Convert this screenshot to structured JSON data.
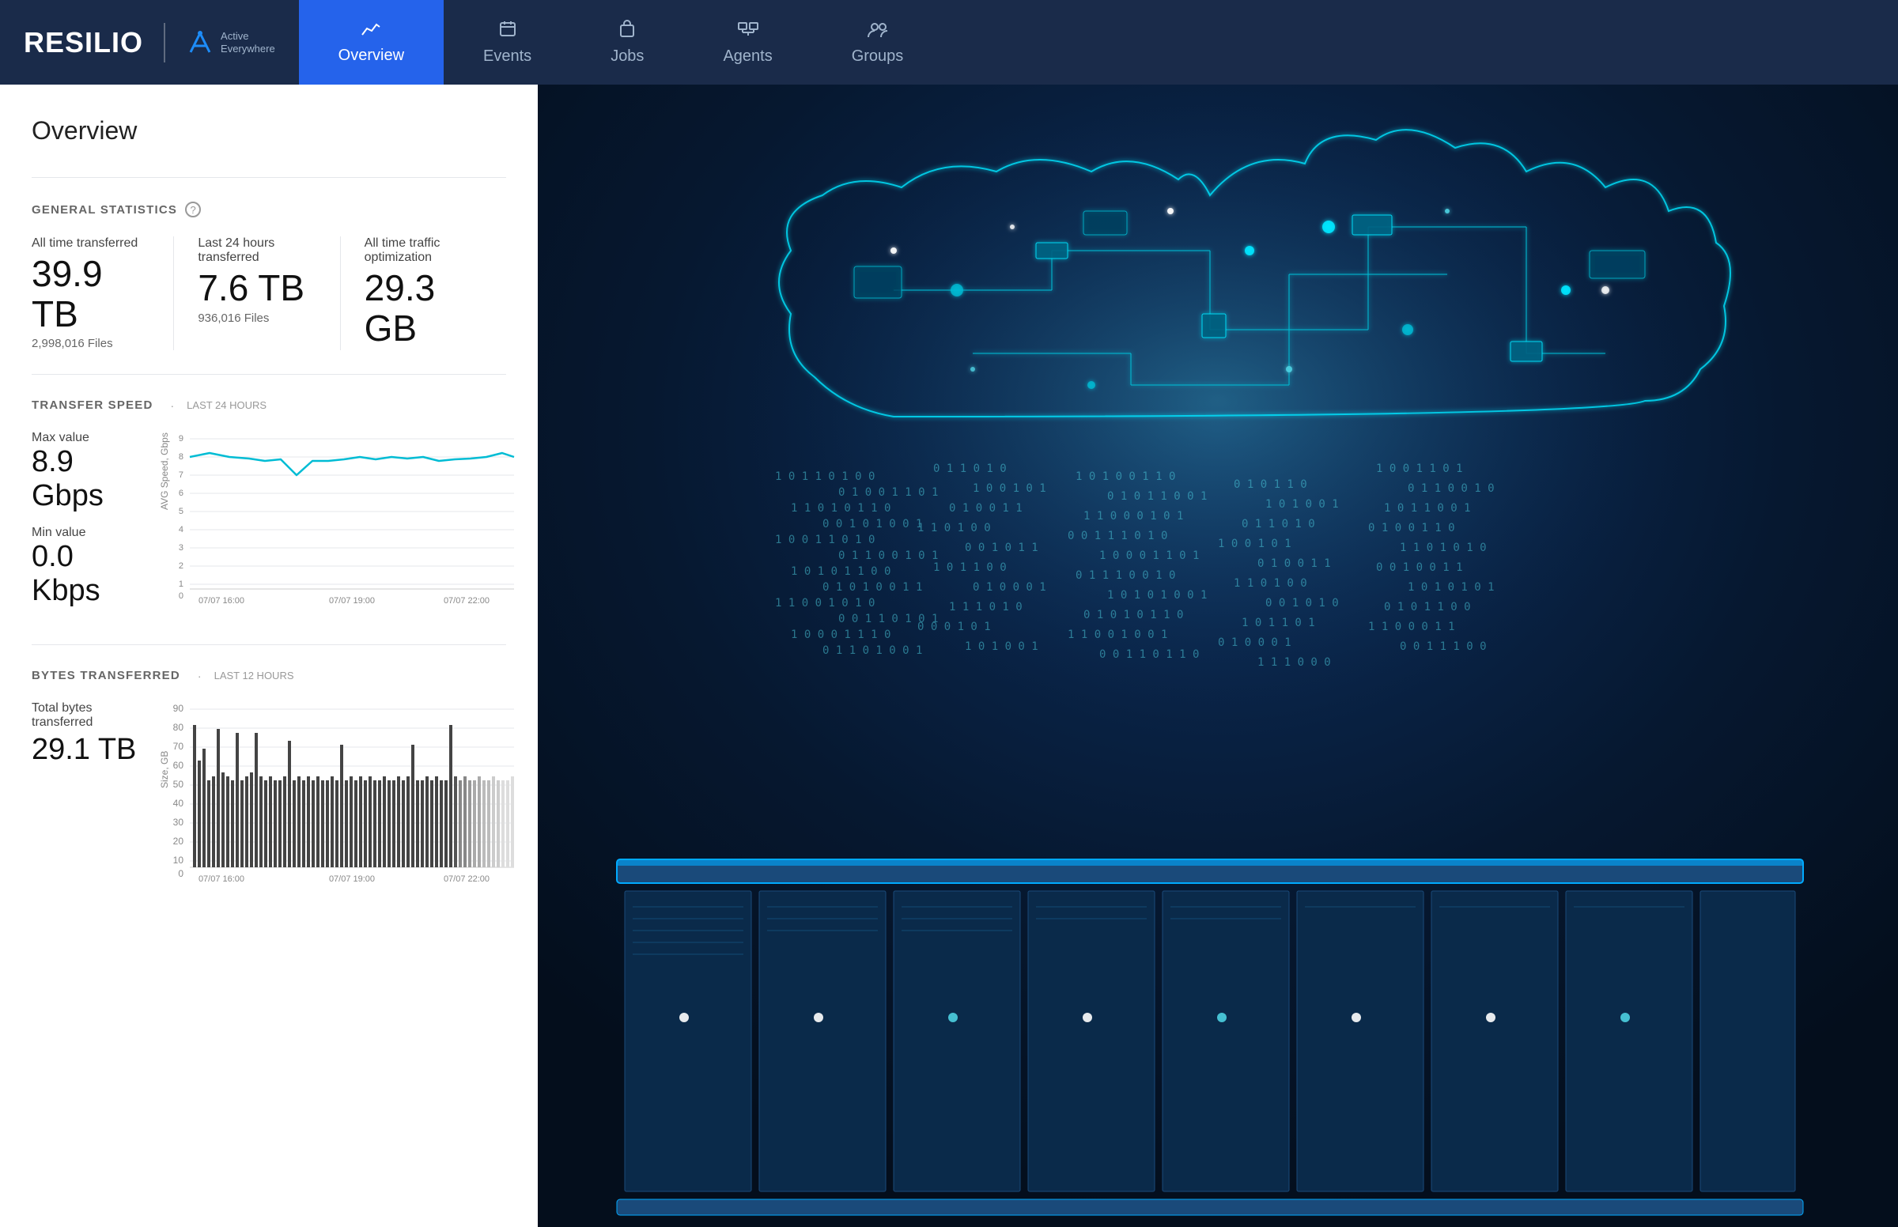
{
  "app": {
    "name": "RESILIO",
    "tagline": "Active Everywhere"
  },
  "nav": {
    "tabs": [
      {
        "id": "overview",
        "label": "Overview",
        "icon": "📊",
        "active": true
      },
      {
        "id": "events",
        "label": "Events",
        "icon": "📋",
        "active": false
      },
      {
        "id": "jobs",
        "label": "Jobs",
        "icon": "💼",
        "active": false
      },
      {
        "id": "agents",
        "label": "Agents",
        "icon": "🖥",
        "active": false
      },
      {
        "id": "groups",
        "label": "Groups",
        "icon": "👥",
        "active": false
      }
    ]
  },
  "page": {
    "title": "Overview"
  },
  "general_statistics": {
    "section_label": "GENERAL STATISTICS",
    "stats": [
      {
        "label": "All time transferred",
        "value": "39.9 TB",
        "sub": "2,998,016 Files"
      },
      {
        "label": "Last 24 hours transferred",
        "value": "7.6 TB",
        "sub": "936,016 Files"
      },
      {
        "label": "All time traffic optimization",
        "value": "29.3 GB",
        "sub": ""
      }
    ]
  },
  "transfer_speed": {
    "section_label": "TRANSFER SPEED",
    "period_label": "LAST 24 HOURS",
    "max_label": "Max value",
    "max_value": "8.9 Gbps",
    "min_label": "Min value",
    "min_value": "0.0 Kbps",
    "y_axis_label": "AVG Speed, Gbps",
    "y_ticks": [
      "9",
      "8",
      "7",
      "6",
      "5",
      "4",
      "3",
      "2",
      "1",
      "0"
    ],
    "x_ticks": [
      "07/07 16:00",
      "07/07 19:00",
      "07/07 22:00"
    ]
  },
  "bytes_transferred": {
    "section_label": "BYTES TRANSFERRED",
    "period_label": "LAST 12 HOURS",
    "total_label": "Total bytes transferred",
    "total_value": "29.1 TB",
    "y_axis_label": "Size, GB",
    "y_ticks": [
      "90",
      "80",
      "70",
      "60",
      "50",
      "40",
      "30",
      "20",
      "10",
      "0"
    ],
    "x_ticks": [
      "07/07 16:00",
      "07/07 19:00",
      "07/07 22:00"
    ]
  }
}
